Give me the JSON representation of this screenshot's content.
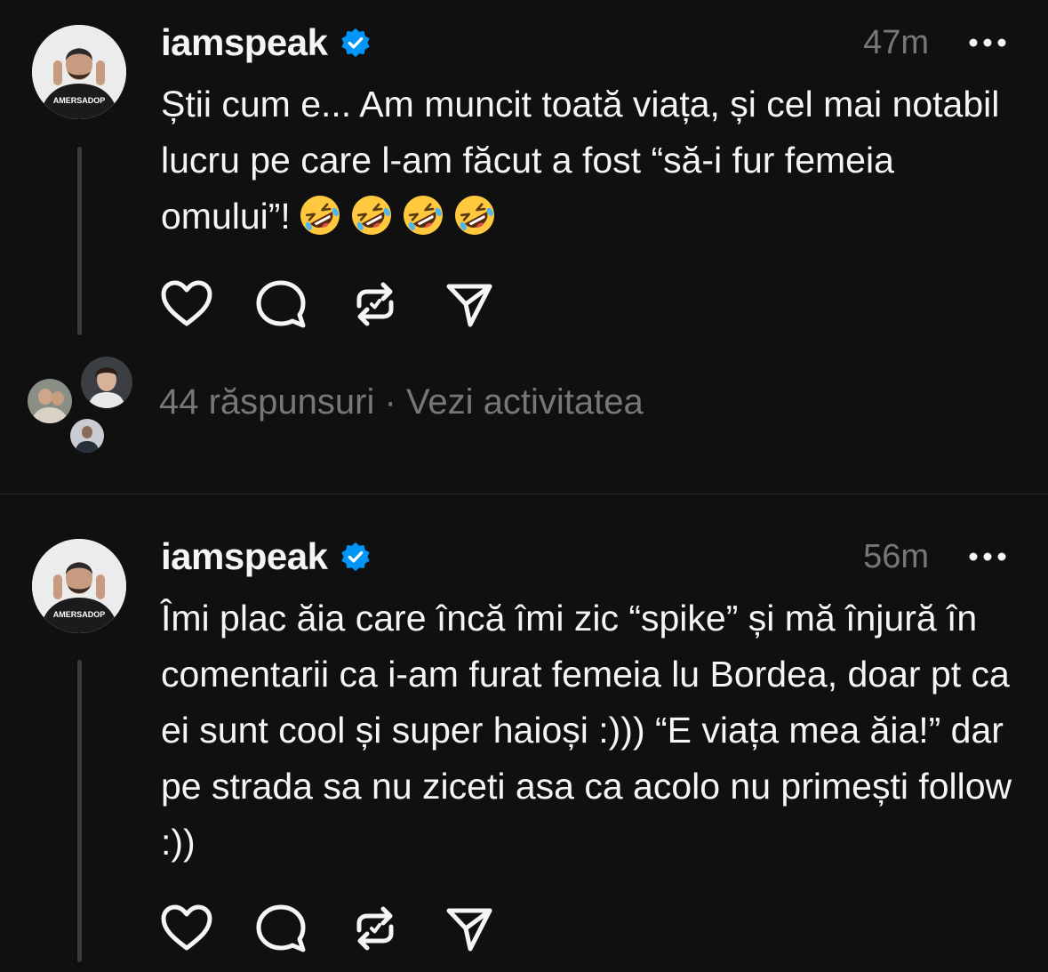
{
  "posts": [
    {
      "username": "iamspeak",
      "time": "47m",
      "text": "Știi cum e... Am muncit toată viața, și cel mai notabil lucru pe care l-am făcut a fost “să-i fur femeia omului”!",
      "emoji": [
        "rolling-on-floor-laughing",
        "rolling-on-floor-laughing",
        "rolling-on-floor-laughing",
        "rolling-on-floor-laughing"
      ]
    },
    {
      "username": "iamspeak",
      "time": "56m",
      "text": "Îmi plac ăia care încă îmi zic “spike” și mă înjură în comentarii ca i-am furat femeia lu Bordea, doar pt ca ei sunt cool și super haioși :))) “E viața mea ăia!” dar pe strada sa nu ziceti asa ca acolo nu primești follow :))"
    }
  ],
  "replies_summary": {
    "count_text": "44 răspunsuri",
    "separator": "·",
    "activity_link": "Vezi activitatea"
  },
  "avatar_shirt_text": "AMERSADOP",
  "colors": {
    "background": "#101010",
    "text": "#f3f5f7",
    "muted": "#777777",
    "verified": "#0095f6",
    "thread_line": "#3a3a3a"
  },
  "icons": {
    "like": "heart-icon",
    "comment": "comment-bubble-icon",
    "repost": "repost-icon",
    "share": "send-icon",
    "more": "more-dots-icon",
    "verified": "verified-badge-icon"
  }
}
